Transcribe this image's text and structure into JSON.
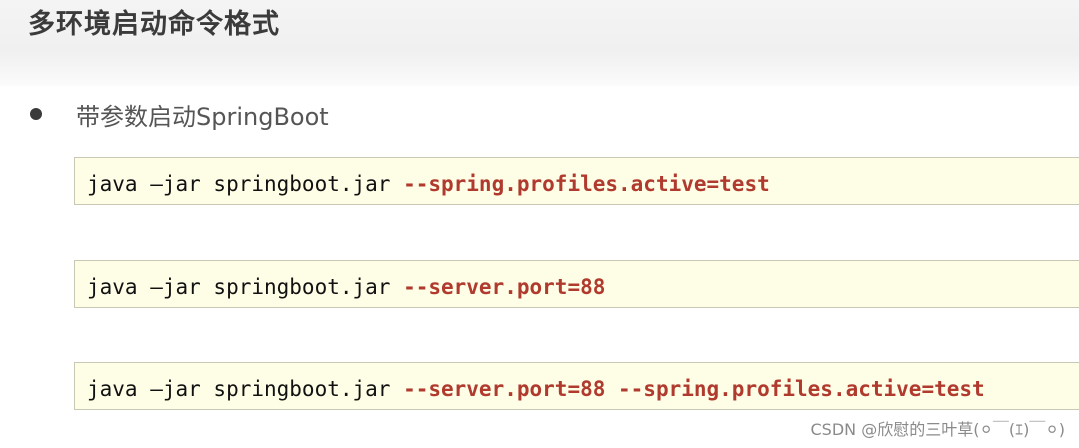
{
  "header": {
    "title": "多环境启动命令格式"
  },
  "bullet": {
    "text": "带参数启动SpringBoot"
  },
  "code_blocks": [
    {
      "command": "java –jar springboot.jar ",
      "args": "--spring.profiles.active=test"
    },
    {
      "command": "java –jar springboot.jar ",
      "args": "--server.port=88"
    },
    {
      "command": "java –jar springboot.jar ",
      "args": "--server.port=88 --spring.profiles.active=test"
    }
  ],
  "watermark": "CSDN @欣慰的三叶草(⚪￣(ｴ)￣⚪)",
  "colors": {
    "code_background": "#fefde6",
    "argument_text": "#b03a2e",
    "title_text": "#3b3b3b"
  }
}
